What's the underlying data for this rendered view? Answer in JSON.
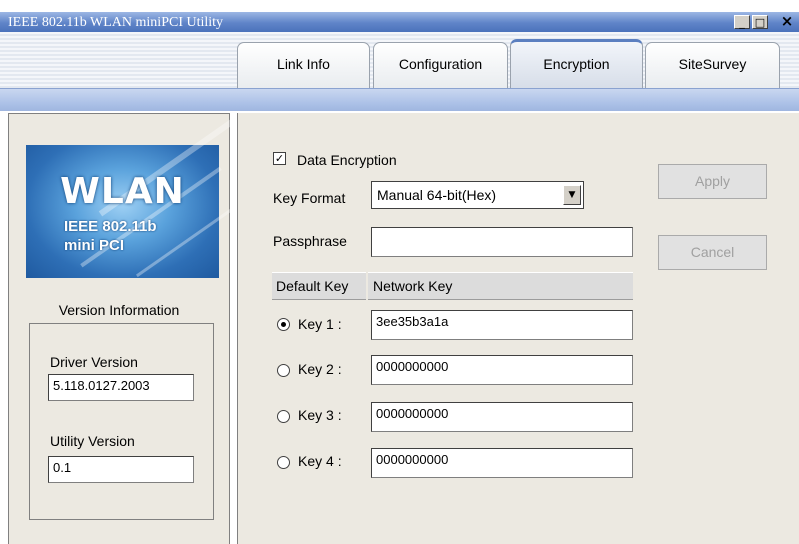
{
  "window": {
    "title": "IEEE 802.11b WLAN miniPCI Utility",
    "minimize_glyph": "_",
    "maximize_glyph": "□",
    "close_glyph": "×"
  },
  "tabs": [
    {
      "label": "Link Info",
      "active": false
    },
    {
      "label": "Configuration",
      "active": false
    },
    {
      "label": "Encryption",
      "active": true
    },
    {
      "label": "SiteSurvey",
      "active": false
    }
  ],
  "logo": {
    "big": "WLAN",
    "line1": "IEEE 802.11b",
    "line2": "mini PCI"
  },
  "version_info": {
    "heading": "Version Information",
    "driver_label": "Driver Version",
    "driver_value": "5.118.0127.2003",
    "utility_label": "Utility Version",
    "utility_value": "0.1"
  },
  "encryption": {
    "data_encryption_label": "Data Encryption",
    "data_encryption_checked": true,
    "key_format_label": "Key Format",
    "key_format_value": "Manual 64-bit(Hex)",
    "passphrase_label": "Passphrase",
    "passphrase_value": "",
    "default_key_header": "Default Key",
    "network_key_header": "Network Key",
    "keys": [
      {
        "label": "Key 1 :",
        "value": "3ee35b3a1a",
        "selected": true
      },
      {
        "label": "Key 2 :",
        "value": "0000000000",
        "selected": false
      },
      {
        "label": "Key 3 :",
        "value": "0000000000",
        "selected": false
      },
      {
        "label": "Key 4 :",
        "value": "0000000000",
        "selected": false
      }
    ]
  },
  "buttons": {
    "apply": "Apply",
    "cancel": "Cancel"
  },
  "colors": {
    "titlebar": "#5f84c8",
    "panel": "#ece9e1",
    "tab_active_border": "#5b7fc0"
  }
}
